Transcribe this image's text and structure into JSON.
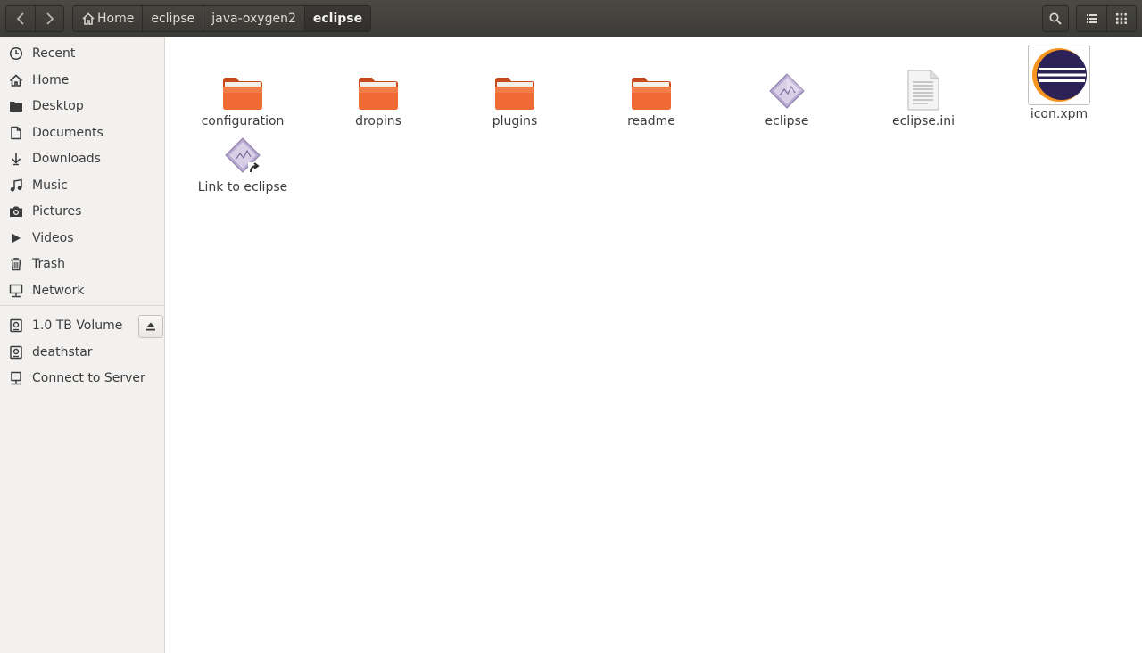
{
  "window": {
    "title": "eclipse"
  },
  "breadcrumbs": [
    {
      "label": "Home",
      "icon": "home-icon"
    },
    {
      "label": "eclipse"
    },
    {
      "label": "java-oxygen2"
    },
    {
      "label": "eclipse",
      "active": true
    }
  ],
  "toolbar": {
    "back_icon": "chevron-left-icon",
    "forward_icon": "chevron-right-icon",
    "search_icon": "search-icon",
    "list_view_icon": "list-view-icon",
    "grid_view_icon": "grid-view-icon"
  },
  "sidebar": {
    "places": [
      {
        "label": "Recent",
        "icon": "clock-icon"
      },
      {
        "label": "Home",
        "icon": "home-icon"
      },
      {
        "label": "Desktop",
        "icon": "desktop-folder-icon"
      },
      {
        "label": "Documents",
        "icon": "document-icon"
      },
      {
        "label": "Downloads",
        "icon": "download-icon"
      },
      {
        "label": "Music",
        "icon": "music-icon"
      },
      {
        "label": "Pictures",
        "icon": "camera-icon"
      },
      {
        "label": "Videos",
        "icon": "video-icon"
      },
      {
        "label": "Trash",
        "icon": "trash-icon"
      },
      {
        "label": "Network",
        "icon": "network-icon"
      }
    ],
    "devices": [
      {
        "label": "1.0 TB Volume",
        "icon": "drive-icon",
        "ejectable": true
      },
      {
        "label": "deathstar",
        "icon": "drive-icon"
      },
      {
        "label": "Connect to Server",
        "icon": "server-icon"
      }
    ]
  },
  "files": [
    {
      "name": "configuration",
      "type": "folder"
    },
    {
      "name": "dropins",
      "type": "folder"
    },
    {
      "name": "plugins",
      "type": "folder"
    },
    {
      "name": "readme",
      "type": "folder"
    },
    {
      "name": "eclipse",
      "type": "executable"
    },
    {
      "name": "eclipse.ini",
      "type": "text"
    },
    {
      "name": "icon.xpm",
      "type": "image"
    },
    {
      "name": "Link to eclipse",
      "type": "symlink"
    }
  ],
  "colors": {
    "header_bg": "#3c3b37",
    "folder_orange": "#e8602f",
    "sidebar_bg": "#f2f1f0",
    "eclipse_purple": "#2c2255",
    "eclipse_orange": "#f7941e"
  }
}
